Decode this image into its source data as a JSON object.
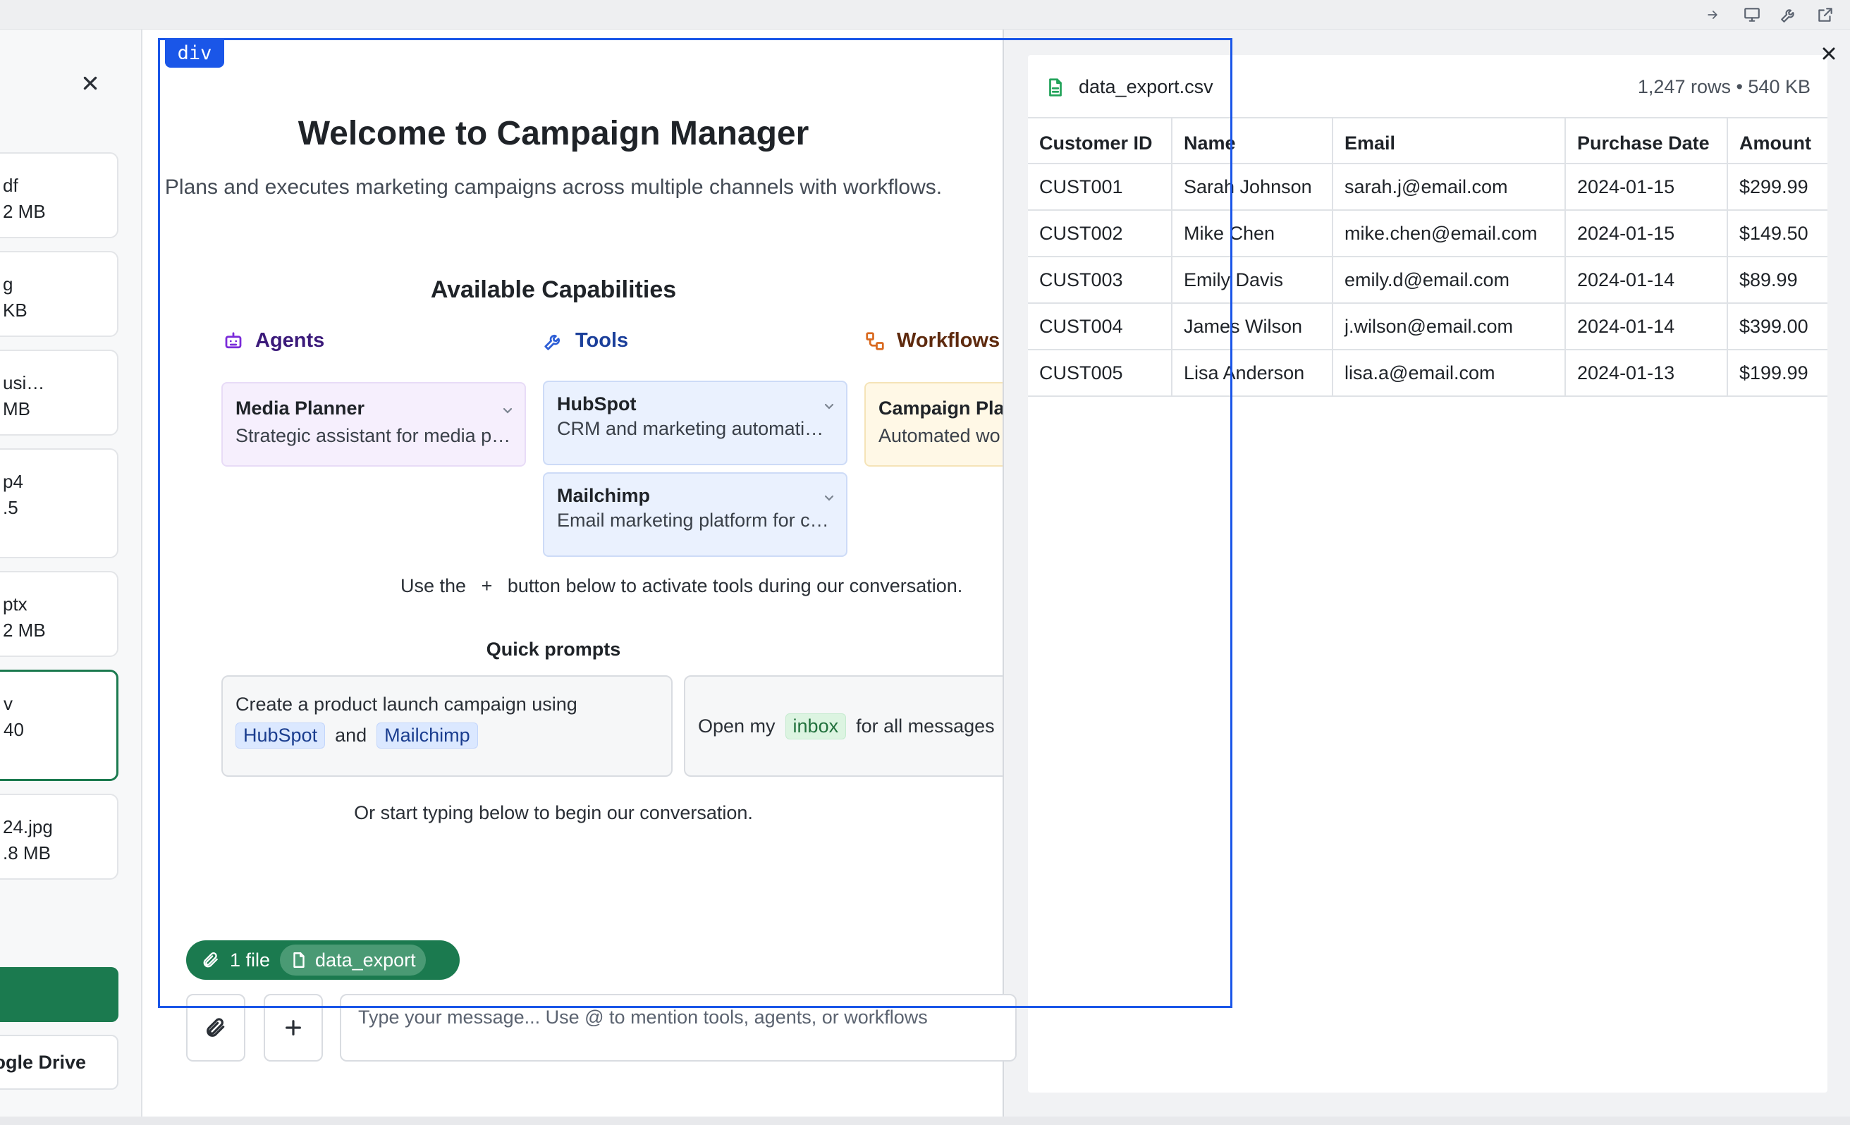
{
  "sidebar": {
    "files": [
      {
        "name": "df",
        "meta": "2 MB"
      },
      {
        "name": "g",
        "meta": "KB"
      },
      {
        "name": "usi…",
        "meta": "MB"
      },
      {
        "name": "p4",
        "meta": ".5"
      },
      {
        "name": "ptx",
        "meta": "2 MB"
      },
      {
        "name": "v",
        "meta": "40"
      },
      {
        "name": "24.jpg",
        "meta": ".8 MB"
      }
    ],
    "google_drive_label": "ogle Drive"
  },
  "main": {
    "title": "Welcome to Campaign Manager",
    "subtitle": "Plans and executes marketing campaigns across multiple channels with workflows.",
    "capabilities_title": "Available Capabilities",
    "agents_label": "Agents",
    "tools_label": "Tools",
    "workflows_label": "Workflows",
    "agents": [
      {
        "name": "Media Planner",
        "desc": "Strategic assistant for media planning"
      }
    ],
    "tools": [
      {
        "name": "HubSpot",
        "desc": "CRM and marketing automation platform"
      },
      {
        "name": "Mailchimp",
        "desc": "Email marketing platform for campaigns"
      }
    ],
    "workflows": [
      {
        "name": "Campaign Plan",
        "desc": "Automated wo"
      }
    ],
    "use_the_prefix": "Use the",
    "plus_glyph": "+",
    "use_the_suffix": "button below to activate tools during our conversation.",
    "quick_prompts_title": "Quick prompts",
    "prompt1": {
      "text": "Create a product launch campaign using",
      "tag1": "HubSpot",
      "and": "and",
      "tag2": "Mailchimp"
    },
    "prompt2": {
      "prefix": "Open my",
      "tag": "inbox",
      "suffix": "for all messages"
    },
    "start_typing": "Or start typing below to begin our conversation.",
    "attachment": {
      "count": "1 file",
      "file": "data_export"
    },
    "input_placeholder": "Type your message... Use @ to mention tools, agents, or workflows"
  },
  "panel": {
    "filename": "data_export.csv",
    "meta": "1,247 rows • 540 KB",
    "columns": [
      "Customer ID",
      "Name",
      "Email",
      "Purchase Date",
      "Amount"
    ],
    "rows": [
      [
        "CUST001",
        "Sarah Johnson",
        "sarah.j@email.com",
        "2024-01-15",
        "$299.99"
      ],
      [
        "CUST002",
        "Mike Chen",
        "mike.chen@email.com",
        "2024-01-15",
        "$149.50"
      ],
      [
        "CUST003",
        "Emily Davis",
        "emily.d@email.com",
        "2024-01-14",
        "$89.99"
      ],
      [
        "CUST004",
        "James Wilson",
        "j.wilson@email.com",
        "2024-01-14",
        "$399.00"
      ],
      [
        "CUST005",
        "Lisa Anderson",
        "lisa.a@email.com",
        "2024-01-13",
        "$199.99"
      ]
    ]
  },
  "inspector": {
    "tag": "div"
  },
  "colors": {
    "accent": "#1b7a4f",
    "inspector": "#1a56e8",
    "agents": "#7a2ad9",
    "tools": "#1b3f9a",
    "workflows": "#8a3a12"
  }
}
